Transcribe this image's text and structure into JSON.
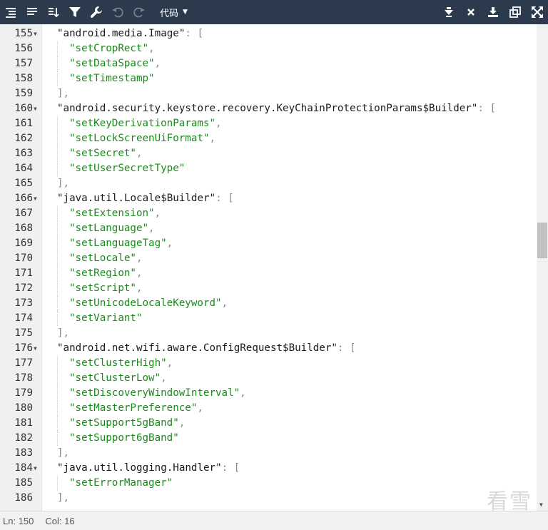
{
  "toolbar": {
    "language": "代码",
    "left_icons": [
      "format-icon",
      "compact-icon",
      "sort-icon",
      "filter-icon",
      "wrench-icon",
      "undo-icon",
      "redo-icon"
    ],
    "right_icons": [
      "arrow-down-icon",
      "close-icon",
      "download-icon",
      "copy-icon",
      "fullscreen-icon"
    ]
  },
  "editor": {
    "lines": [
      {
        "n": "155",
        "fold": true,
        "indent": 0,
        "key": "\"android.media.Image\"",
        "punc": ": ["
      },
      {
        "n": "156",
        "indent": 1,
        "str": "\"setCropRect\"",
        "punc": ","
      },
      {
        "n": "157",
        "indent": 1,
        "str": "\"setDataSpace\"",
        "punc": ","
      },
      {
        "n": "158",
        "indent": 1,
        "str": "\"setTimestamp\"",
        "punc": ""
      },
      {
        "n": "159",
        "indent": 0,
        "punc": "],"
      },
      {
        "n": "160",
        "fold": true,
        "indent": 0,
        "key": "\"android.security.keystore.recovery.KeyChainProtectionParams$Builder\"",
        "punc": ": ["
      },
      {
        "n": "161",
        "indent": 1,
        "str": "\"setKeyDerivationParams\"",
        "punc": ","
      },
      {
        "n": "162",
        "indent": 1,
        "str": "\"setLockScreenUiFormat\"",
        "punc": ","
      },
      {
        "n": "163",
        "indent": 1,
        "str": "\"setSecret\"",
        "punc": ","
      },
      {
        "n": "164",
        "indent": 1,
        "str": "\"setUserSecretType\"",
        "punc": ""
      },
      {
        "n": "165",
        "indent": 0,
        "punc": "],"
      },
      {
        "n": "166",
        "fold": true,
        "indent": 0,
        "key": "\"java.util.Locale$Builder\"",
        "punc": ": ["
      },
      {
        "n": "167",
        "indent": 1,
        "str": "\"setExtension\"",
        "punc": ","
      },
      {
        "n": "168",
        "indent": 1,
        "str": "\"setLanguage\"",
        "punc": ","
      },
      {
        "n": "169",
        "indent": 1,
        "str": "\"setLanguageTag\"",
        "punc": ","
      },
      {
        "n": "170",
        "indent": 1,
        "str": "\"setLocale\"",
        "punc": ","
      },
      {
        "n": "171",
        "indent": 1,
        "str": "\"setRegion\"",
        "punc": ","
      },
      {
        "n": "172",
        "indent": 1,
        "str": "\"setScript\"",
        "punc": ","
      },
      {
        "n": "173",
        "indent": 1,
        "str": "\"setUnicodeLocaleKeyword\"",
        "punc": ","
      },
      {
        "n": "174",
        "indent": 1,
        "str": "\"setVariant\"",
        "punc": ""
      },
      {
        "n": "175",
        "indent": 0,
        "punc": "],"
      },
      {
        "n": "176",
        "fold": true,
        "indent": 0,
        "key": "\"android.net.wifi.aware.ConfigRequest$Builder\"",
        "punc": ": ["
      },
      {
        "n": "177",
        "indent": 1,
        "str": "\"setClusterHigh\"",
        "punc": ","
      },
      {
        "n": "178",
        "indent": 1,
        "str": "\"setClusterLow\"",
        "punc": ","
      },
      {
        "n": "179",
        "indent": 1,
        "str": "\"setDiscoveryWindowInterval\"",
        "punc": ","
      },
      {
        "n": "180",
        "indent": 1,
        "str": "\"setMasterPreference\"",
        "punc": ","
      },
      {
        "n": "181",
        "indent": 1,
        "str": "\"setSupport5gBand\"",
        "punc": ","
      },
      {
        "n": "182",
        "indent": 1,
        "str": "\"setSupport6gBand\"",
        "punc": ""
      },
      {
        "n": "183",
        "indent": 0,
        "punc": "],"
      },
      {
        "n": "184",
        "fold": true,
        "indent": 0,
        "key": "\"java.util.logging.Handler\"",
        "punc": ": ["
      },
      {
        "n": "185",
        "indent": 1,
        "str": "\"setErrorManager\"",
        "punc": ""
      },
      {
        "n": "186",
        "indent": 0,
        "punc": "],"
      }
    ]
  },
  "status": {
    "line": "Ln: 150",
    "col": "Col: 16"
  },
  "watermark": "看雪",
  "colors": {
    "toolbar_bg": "#2b3a4c",
    "string": "#1a8a1a",
    "punctuation": "#8a8a8a",
    "gutter_bg": "#f0f0f0"
  }
}
